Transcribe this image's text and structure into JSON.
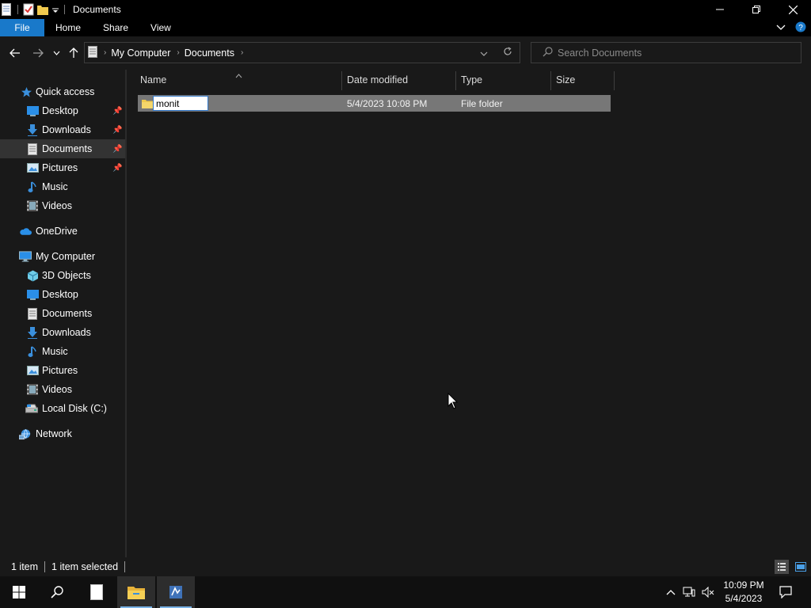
{
  "window": {
    "title": "Documents"
  },
  "ribbon": {
    "tabs": [
      "File",
      "Home",
      "Share",
      "View"
    ]
  },
  "address": {
    "segments": [
      "My Computer",
      "Documents"
    ]
  },
  "search": {
    "placeholder": "Search Documents"
  },
  "sidebar": {
    "quick_access": {
      "label": "Quick access",
      "icon": "star-icon"
    },
    "quick_items": [
      {
        "label": "Desktop",
        "icon": "desktop-icon",
        "pinned": true
      },
      {
        "label": "Downloads",
        "icon": "downloads-icon",
        "pinned": true
      },
      {
        "label": "Documents",
        "icon": "documents-icon",
        "pinned": true,
        "selected": true
      },
      {
        "label": "Pictures",
        "icon": "pictures-icon",
        "pinned": true
      },
      {
        "label": "Music",
        "icon": "music-icon",
        "pinned": false
      },
      {
        "label": "Videos",
        "icon": "videos-icon",
        "pinned": false
      }
    ],
    "onedrive": {
      "label": "OneDrive",
      "icon": "onedrive-icon"
    },
    "computer": {
      "label": "My Computer",
      "icon": "computer-icon"
    },
    "computer_items": [
      {
        "label": "3D Objects",
        "icon": "3d-objects-icon"
      },
      {
        "label": "Desktop",
        "icon": "desktop-icon"
      },
      {
        "label": "Documents",
        "icon": "documents-icon"
      },
      {
        "label": "Downloads",
        "icon": "downloads-icon"
      },
      {
        "label": "Music",
        "icon": "music-icon"
      },
      {
        "label": "Pictures",
        "icon": "pictures-icon"
      },
      {
        "label": "Videos",
        "icon": "videos-icon"
      },
      {
        "label": "Local Disk (C:)",
        "icon": "local-disk-icon"
      }
    ],
    "network": {
      "label": "Network",
      "icon": "network-icon"
    }
  },
  "columns": {
    "name": "Name",
    "date": "Date modified",
    "type": "Type",
    "size": "Size"
  },
  "files": [
    {
      "name": "monit",
      "date": "5/4/2023 10:08 PM",
      "type": "File folder",
      "size": "",
      "selected": true,
      "renaming": true
    }
  ],
  "status": {
    "count": "1 item",
    "selection": "1 item selected"
  },
  "taskbar": {
    "time": "10:09 PM",
    "date": "5/4/2023"
  },
  "colors": {
    "accent": "#1979ca",
    "folder": "#f0c94e",
    "selection_row": "#777777",
    "background": "#191919"
  }
}
